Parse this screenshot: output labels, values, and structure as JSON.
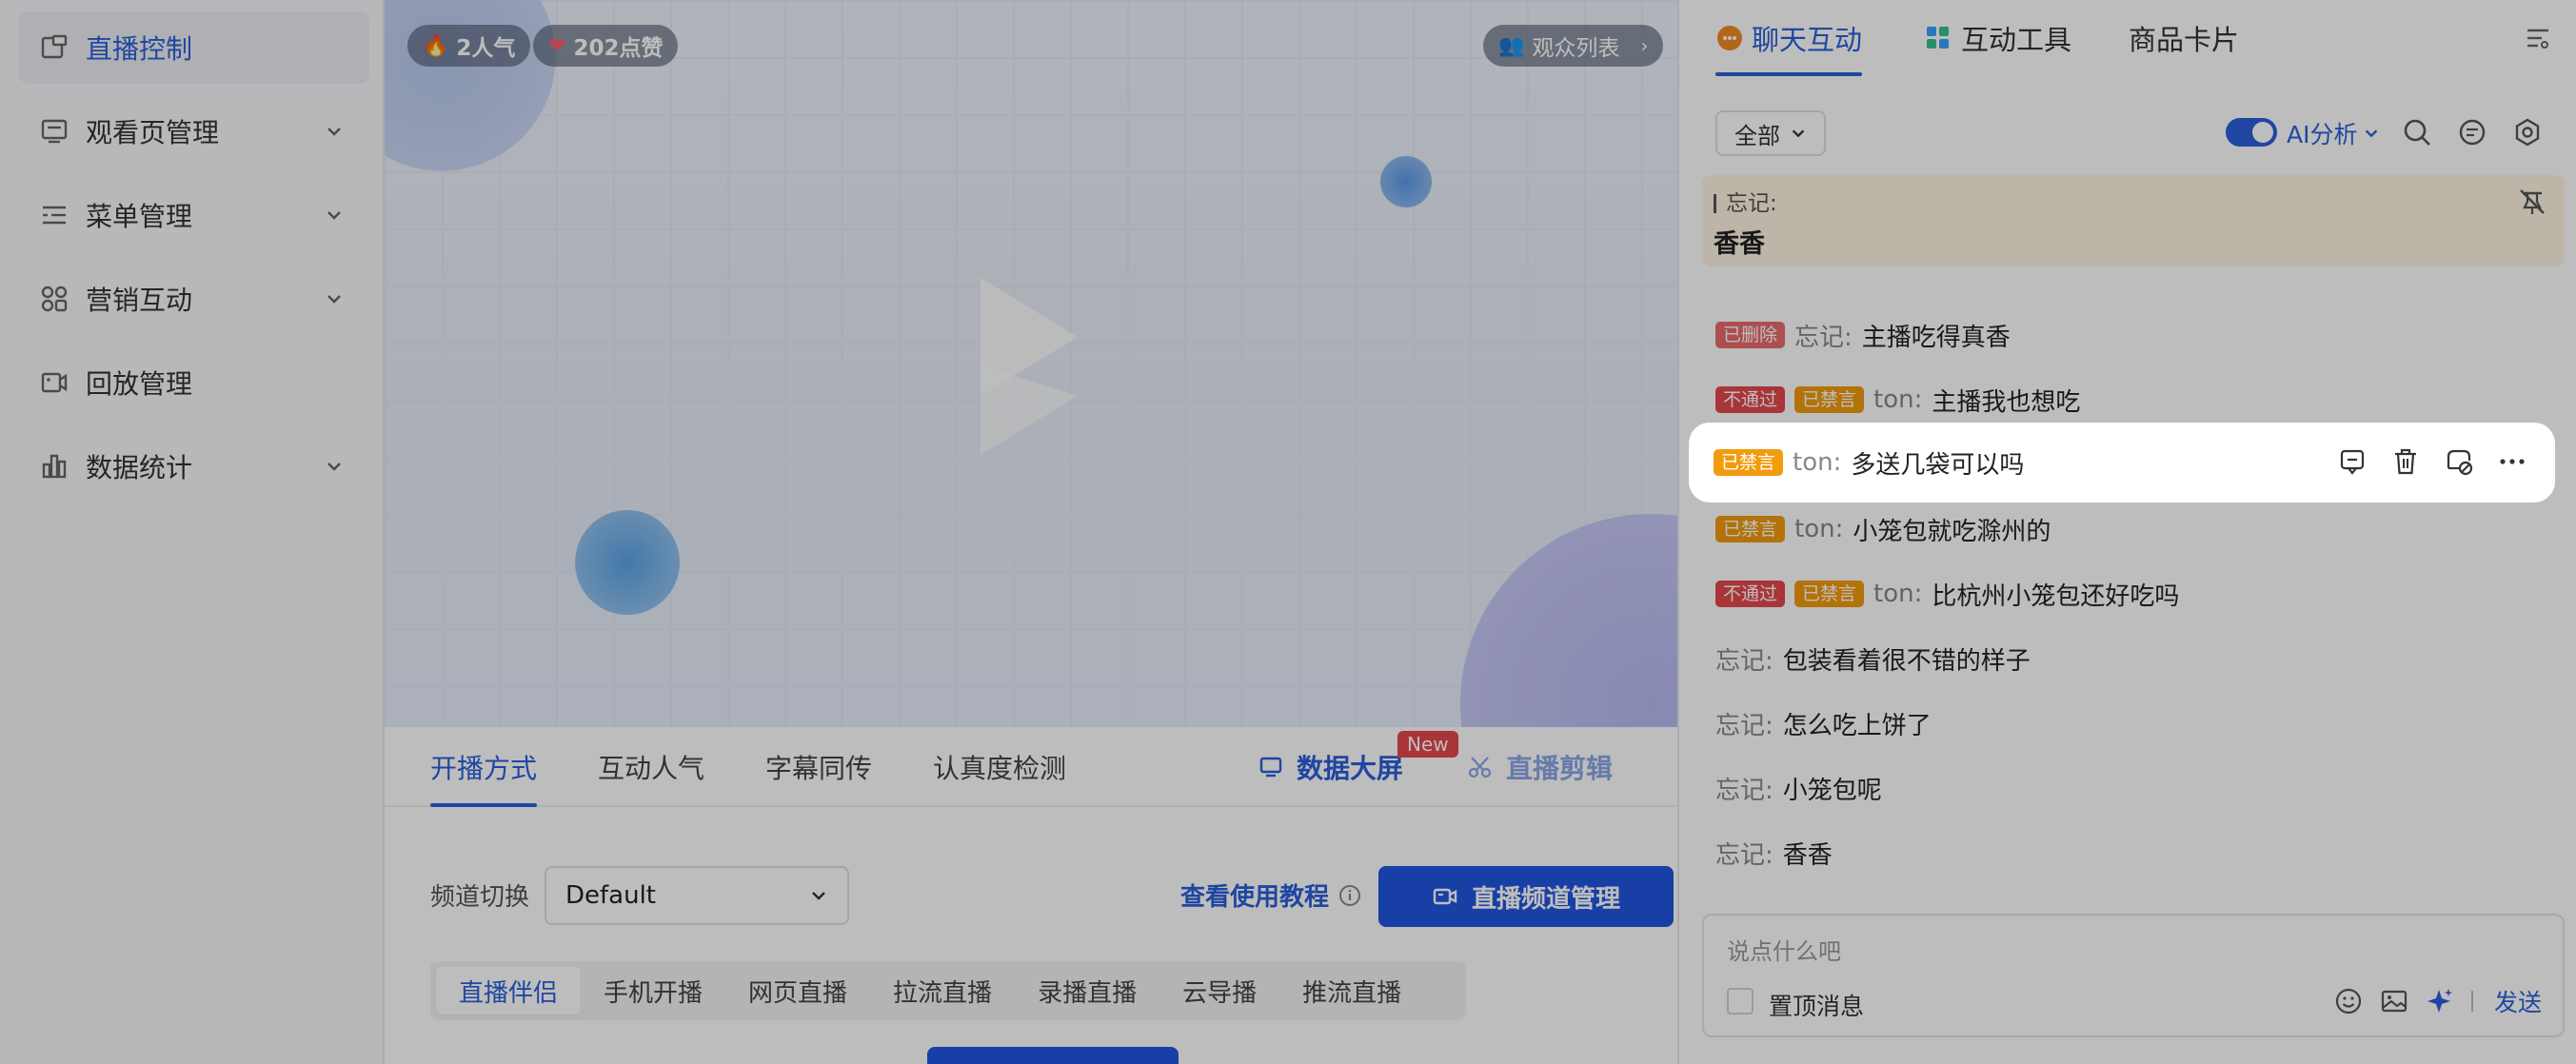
{
  "sidebar": {
    "items": [
      {
        "label": "直播控制",
        "icon": "live-control-icon",
        "active": true,
        "expandable": false
      },
      {
        "label": "观看页管理",
        "icon": "watch-page-icon",
        "active": false,
        "expandable": true
      },
      {
        "label": "菜单管理",
        "icon": "menu-icon",
        "active": false,
        "expandable": true
      },
      {
        "label": "营销互动",
        "icon": "marketing-icon",
        "active": false,
        "expandable": true
      },
      {
        "label": "回放管理",
        "icon": "playback-icon",
        "active": false,
        "expandable": false
      },
      {
        "label": "数据统计",
        "icon": "stats-icon",
        "active": false,
        "expandable": true
      }
    ]
  },
  "video": {
    "popularity": "2人气",
    "likes": "202点赞",
    "audience_list": "观众列表"
  },
  "main_tabs": {
    "items": [
      "开播方式",
      "互动人气",
      "字幕同传",
      "认真度检测"
    ],
    "active": 0,
    "data_screen": "数据大屏",
    "new_badge": "New",
    "live_clip": "直播剪辑"
  },
  "channel": {
    "label": "频道切换",
    "selected": "Default",
    "tutorial": "查看使用教程",
    "manage_button": "直播频道管理"
  },
  "modes": {
    "items": [
      "直播伴侣",
      "手机开播",
      "网页直播",
      "拉流直播",
      "录播直播",
      "云导播",
      "推流直播"
    ],
    "active": 0
  },
  "chat": {
    "tabs": [
      "聊天互动",
      "互动工具",
      "商品卡片"
    ],
    "active_tab": 0,
    "filter": "全部",
    "ai_label": "AI分析",
    "pinned": {
      "name": "忘记:",
      "message": "香香"
    },
    "messages": [
      {
        "tags": [
          {
            "label": "已删除",
            "kind": "del"
          }
        ],
        "user": "忘记:",
        "text": "主播吃得真香"
      },
      {
        "tags": [
          {
            "label": "不通过",
            "kind": "fail"
          },
          {
            "label": "已禁言",
            "kind": "mute"
          }
        ],
        "user": "ton:",
        "text": "主播我也想吃"
      },
      {
        "tags": [
          {
            "label": "已禁言",
            "kind": "mute"
          }
        ],
        "user": "ton:",
        "text": "多送几袋可以吗",
        "highlighted": true
      },
      {
        "tags": [
          {
            "label": "已禁言",
            "kind": "mute"
          }
        ],
        "user": "ton:",
        "text": "小笼包就吃滁州的"
      },
      {
        "tags": [
          {
            "label": "不通过",
            "kind": "fail"
          },
          {
            "label": "已禁言",
            "kind": "mute"
          }
        ],
        "user": "ton:",
        "text": "比杭州小笼包还好吃吗"
      },
      {
        "tags": [],
        "user": "忘记:",
        "text": "包装看着很不错的样子"
      },
      {
        "tags": [],
        "user": "忘记:",
        "text": "怎么吃上饼了"
      },
      {
        "tags": [],
        "user": "忘记:",
        "text": "小笼包呢"
      },
      {
        "tags": [],
        "user": "忘记:",
        "text": "香香"
      }
    ],
    "composer": {
      "placeholder": "说点什么吧",
      "pin_label": "置顶消息",
      "send": "发送"
    }
  },
  "colors": {
    "accent": "#2b5fd9",
    "primary_button": "#1f55e0",
    "tag_deleted": "#e86b6b",
    "tag_failed": "#e5484d",
    "tag_muted": "#f29b0d",
    "pinned_bg": "#fff4e2"
  }
}
